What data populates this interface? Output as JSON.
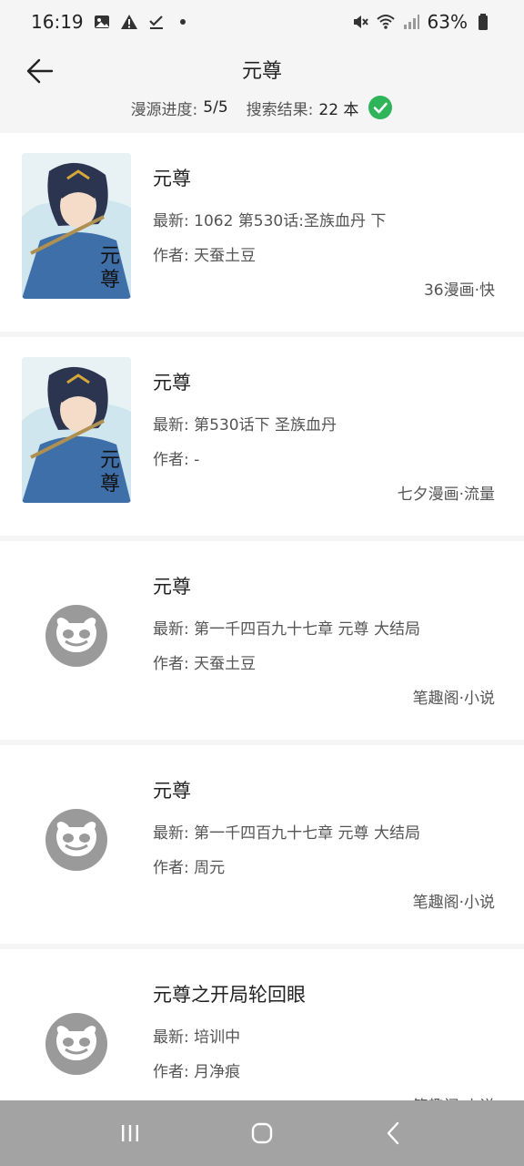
{
  "status": {
    "time": "16:19",
    "battery": "63%"
  },
  "header": {
    "title": "元尊",
    "progress_label": "漫源进度:",
    "progress_value": "5/5",
    "results_label": "搜索结果:",
    "results_value": "22 本"
  },
  "results": [
    {
      "title": "元尊",
      "latest": "最新: 1062 第530话:圣族血丹 下",
      "author": "作者: 天蚕土豆",
      "source": "36漫画·快",
      "cover": "manga-cover"
    },
    {
      "title": "元尊",
      "latest": "最新: 第530话下 圣族血丹",
      "author": "作者: -",
      "source": "七夕漫画·流量",
      "cover": "manga-cover"
    },
    {
      "title": "元尊",
      "latest": "最新: 第一千四百九十七章 元尊 大结局",
      "author": "作者: 天蚕土豆",
      "source": "笔趣阁·小说",
      "cover": "placeholder-avatar"
    },
    {
      "title": "元尊",
      "latest": "最新: 第一千四百九十七章 元尊 大结局",
      "author": "作者: 周元",
      "source": "笔趣阁·小说",
      "cover": "placeholder-avatar"
    },
    {
      "title": "元尊之开局轮回眼",
      "latest": "最新: 培训中",
      "author": "作者: 月净痕",
      "source": "笔趣阁·小说",
      "cover": "placeholder-avatar"
    }
  ],
  "colors": {
    "accent_green": "#2fb45a",
    "nav_bar": "#a3a3a3",
    "placeholder_gray": "#9a9a9a"
  },
  "nav": {
    "recents_icon": "recents-icon",
    "home_icon": "home-icon",
    "back_icon": "back-icon"
  }
}
